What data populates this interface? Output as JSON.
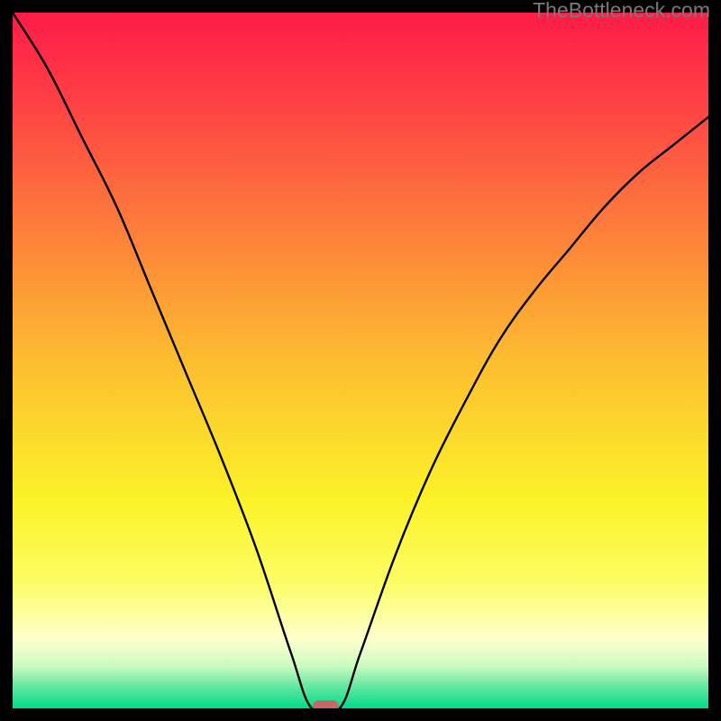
{
  "watermark": "TheBottleneck.com",
  "chart_data": {
    "type": "line",
    "title": "",
    "xlabel": "",
    "ylabel": "",
    "x_range": [
      0,
      1
    ],
    "y_range": [
      0,
      1
    ],
    "min_x": 0.43,
    "series": [
      {
        "name": "curve",
        "points": [
          {
            "x": 0.0,
            "y": 1.0
          },
          {
            "x": 0.05,
            "y": 0.92
          },
          {
            "x": 0.1,
            "y": 0.82
          },
          {
            "x": 0.15,
            "y": 0.72
          },
          {
            "x": 0.2,
            "y": 0.6
          },
          {
            "x": 0.25,
            "y": 0.48
          },
          {
            "x": 0.3,
            "y": 0.36
          },
          {
            "x": 0.35,
            "y": 0.23
          },
          {
            "x": 0.4,
            "y": 0.08
          },
          {
            "x": 0.43,
            "y": 0.0
          },
          {
            "x": 0.47,
            "y": 0.0
          },
          {
            "x": 0.5,
            "y": 0.08
          },
          {
            "x": 0.55,
            "y": 0.22
          },
          {
            "x": 0.6,
            "y": 0.34
          },
          {
            "x": 0.65,
            "y": 0.44
          },
          {
            "x": 0.7,
            "y": 0.53
          },
          {
            "x": 0.75,
            "y": 0.6
          },
          {
            "x": 0.8,
            "y": 0.66
          },
          {
            "x": 0.85,
            "y": 0.72
          },
          {
            "x": 0.9,
            "y": 0.77
          },
          {
            "x": 0.95,
            "y": 0.81
          },
          {
            "x": 1.0,
            "y": 0.85
          }
        ]
      }
    ],
    "marker": {
      "x": 0.45,
      "y": 0.0,
      "color": "#c36a63"
    },
    "gradient_stops": [
      {
        "offset": 0.0,
        "color": "#fe1c47"
      },
      {
        "offset": 0.12,
        "color": "#fe3e44"
      },
      {
        "offset": 0.3,
        "color": "#fd7a3b"
      },
      {
        "offset": 0.5,
        "color": "#fdbd30"
      },
      {
        "offset": 0.7,
        "color": "#fbf228"
      },
      {
        "offset": 0.82,
        "color": "#fcfd65"
      },
      {
        "offset": 0.9,
        "color": "#ffffce"
      },
      {
        "offset": 0.94,
        "color": "#c9fcbf"
      },
      {
        "offset": 0.965,
        "color": "#70e9a4"
      },
      {
        "offset": 1.0,
        "color": "#00db8a"
      }
    ]
  }
}
